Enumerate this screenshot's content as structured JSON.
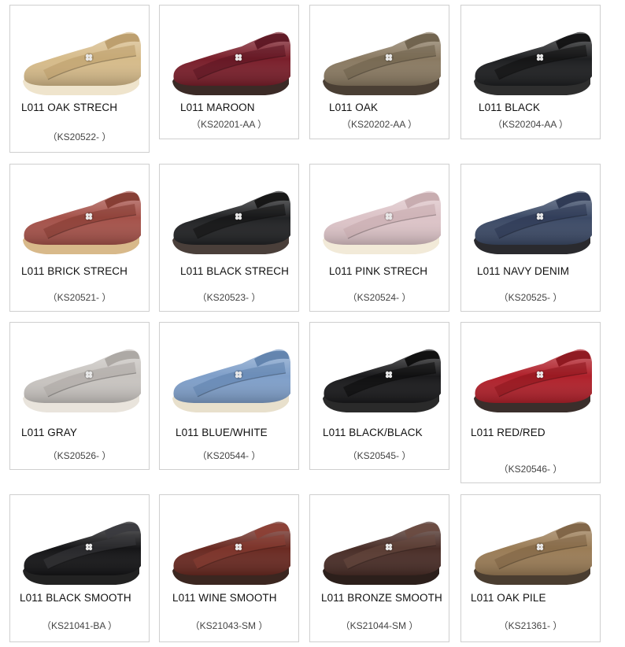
{
  "products": [
    {
      "name": "L011 OAK STRECH",
      "code": "（KS20522- ）",
      "upper": "#d6bb8a",
      "sole": "#efe4cc",
      "trim": "#b99a68"
    },
    {
      "name": "L011 MAROON",
      "code": "（KS20201-AA ）",
      "upper": "#7a1f2b",
      "sole": "#3b2a26",
      "trim": "#5a1420"
    },
    {
      "name": "L011 OAK",
      "code": "（KS20202-AA ）",
      "upper": "#8a7a62",
      "sole": "#4a3f34",
      "trim": "#6c5e49"
    },
    {
      "name": "L011 BLACK",
      "code": "（KS20204-AA ）",
      "upper": "#1e1f21",
      "sole": "#2e2e2e",
      "trim": "#0e0e0f"
    },
    {
      "name": "L011 BRICK STRECH",
      "code": "（KS20521- ）",
      "upper": "#a5524a",
      "sole": "#d8b98a",
      "trim": "#82382f"
    },
    {
      "name": "L011 BLACK STRECH",
      "code": "（KS20523- ）",
      "upper": "#222325",
      "sole": "#4a3f3a",
      "trim": "#111"
    },
    {
      "name": "L011 PINK STRECH",
      "code": "（KS20524- ）",
      "upper": "#dcc3c7",
      "sole": "#f2ead8",
      "trim": "#c4a8ac"
    },
    {
      "name": "L011 NAVY DENIM",
      "code": "（KS20525- ）",
      "upper": "#3c4a66",
      "sole": "#2a2a2e",
      "trim": "#2a3550"
    },
    {
      "name": "L011 GRAY",
      "code": "（KS20526- ）",
      "upper": "#c8c4c0",
      "sole": "#e9e4dc",
      "trim": "#a9a4a0"
    },
    {
      "name": "L011 BLUE/WHITE",
      "code": "（KS20544- ）",
      "upper": "#7f9fc9",
      "sole": "#e8e0cc",
      "trim": "#5d7fab"
    },
    {
      "name": "L011 BLACK/BLACK",
      "code": "（KS20545- ）",
      "upper": "#1a1a1c",
      "sole": "#2a2a2a",
      "trim": "#0a0a0a"
    },
    {
      "name": "L011 RED/RED",
      "code": "（KS20546- ）",
      "upper": "#b0212b",
      "sole": "#3a2e2b",
      "trim": "#8a141c"
    },
    {
      "name": "L011 BLACK SMOOTH",
      "code": "（KS21041-BA ）",
      "upper": "#151517",
      "sole": "#222",
      "trim": "#3a3a3e"
    },
    {
      "name": "L011 WINE SMOOTH",
      "code": "（KS21043-SM ）",
      "upper": "#6a2a22",
      "sole": "#3b2620",
      "trim": "#8c3e33"
    },
    {
      "name": "L011 BRONZE SMOOTH",
      "code": "（KS21044-SM ）",
      "upper": "#4a2e28",
      "sole": "#2c1f1b",
      "trim": "#6a4a40"
    },
    {
      "name": "L011 OAK PILE",
      "code": "（KS21361- ）",
      "upper": "#9a7c56",
      "sole": "#4a3d30",
      "trim": "#7c6142"
    }
  ]
}
